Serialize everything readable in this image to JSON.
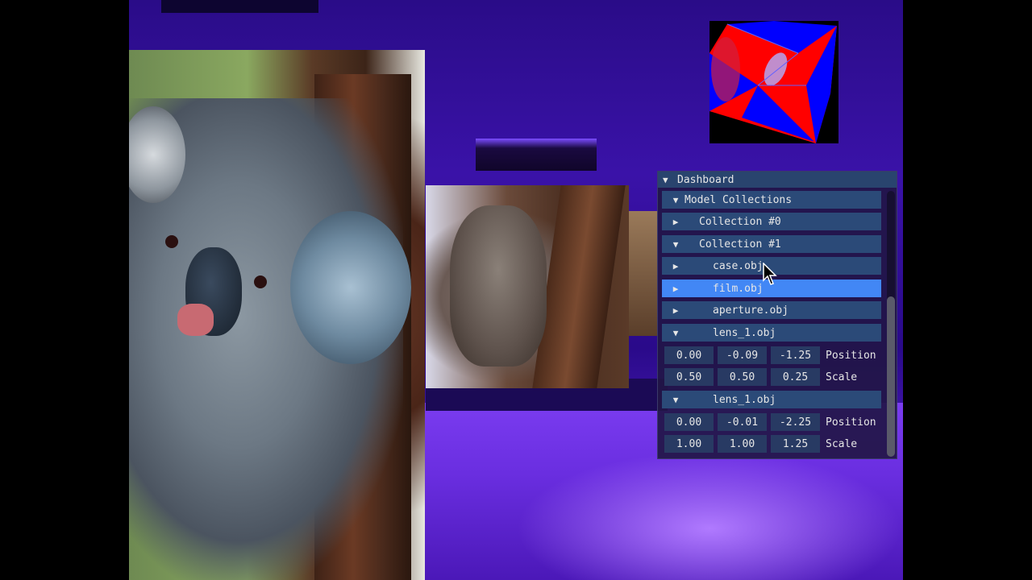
{
  "scene": {
    "photos": [
      "koala-front",
      "koala-mid",
      "koala-side"
    ],
    "cube_colors": [
      "#ff0000",
      "#0000ff"
    ]
  },
  "dashboard": {
    "title": "Dashboard",
    "model_collections_label": "Model Collections",
    "collections": [
      {
        "label": "Collection #0",
        "expanded": false
      },
      {
        "label": "Collection #1",
        "expanded": true
      }
    ],
    "objects": [
      {
        "label": "case.obj",
        "expanded": false,
        "selected": false
      },
      {
        "label": "film.obj",
        "expanded": false,
        "selected": true
      },
      {
        "label": "aperture.obj",
        "expanded": false,
        "selected": false
      },
      {
        "label": "lens_1.obj",
        "expanded": true,
        "selected": false,
        "position": [
          "0.00",
          "-0.09",
          "-1.25"
        ],
        "scale": [
          "0.50",
          "0.50",
          "0.25"
        ]
      },
      {
        "label": "lens_1.obj",
        "expanded": true,
        "selected": false,
        "position": [
          "0.00",
          "-0.01",
          "-2.25"
        ],
        "scale": [
          "1.00",
          "1.00",
          "1.25"
        ]
      }
    ],
    "position_label": "Position",
    "scale_label": "Scale",
    "arrow_collapsed": "▶",
    "arrow_expanded": "▼",
    "colors": {
      "title_bg": "#29446e",
      "header_bg": "#2b4a78",
      "selected_bg": "#4287f5",
      "frame_bg": "#283a63"
    }
  }
}
